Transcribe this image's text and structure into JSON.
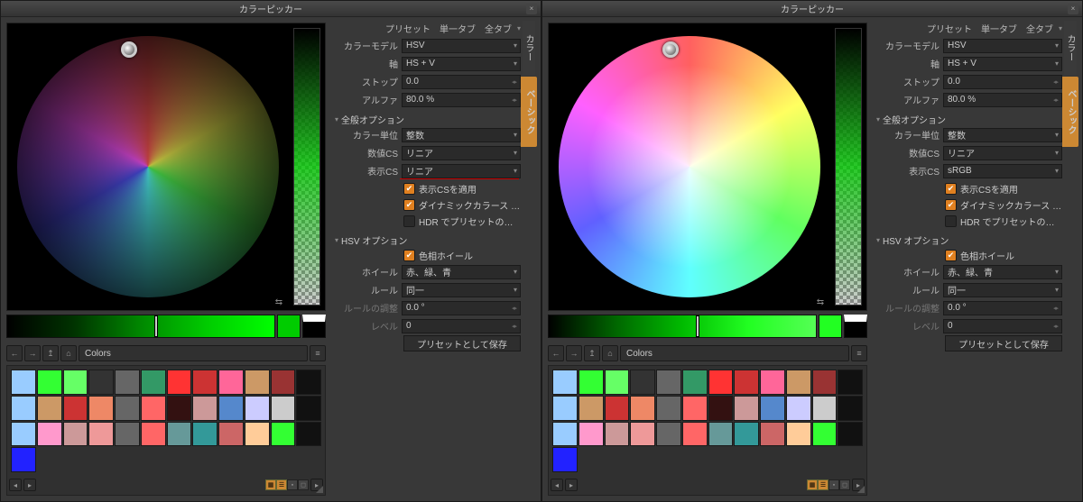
{
  "title": "カラーピッカー",
  "header": {
    "preset": "プリセット",
    "single": "単一タブ",
    "all": "全タブ"
  },
  "labels": {
    "color_model": "カラーモデル",
    "axis": "軸",
    "stop": "ストップ",
    "alpha": "アルファ",
    "general": "全般オプション",
    "color_unit": "カラー単位",
    "numeric_cs": "数値CS",
    "display_cs": "表示CS",
    "apply_display_cs": "表示CSを適用",
    "dynamic_color": "ダイナミックカラース …",
    "hdr_preset": "HDR でプリセットの…",
    "hsv_options": "HSV オプション",
    "hue_wheel": "色相ホイール",
    "wheel": "ホイール",
    "rule": "ルール",
    "rule_adjust": "ルールの調整",
    "level": "レベル",
    "save_preset": "プリセットとして保存",
    "vtab": "ベーシック",
    "vtab2": "カラー"
  },
  "left": {
    "color_model": "HSV",
    "axis": "HS + V",
    "stop": "0.0",
    "alpha": "80.0 %",
    "color_unit": "整数",
    "numeric_cs": "リニア",
    "display_cs": "リニア",
    "apply_display_cs": true,
    "dynamic_color": true,
    "hdr_preset": false,
    "hue_wheel": true,
    "wheel": "赤、緑、青",
    "rule": "同一",
    "rule_adjust": "0.0 °",
    "level": "0",
    "colors_label": "Colors"
  },
  "right": {
    "color_model": "HSV",
    "axis": "HS + V",
    "stop": "0.0",
    "alpha": "80.0 %",
    "color_unit": "整数",
    "numeric_cs": "リニア",
    "display_cs": "sRGB",
    "apply_display_cs": true,
    "dynamic_color": true,
    "hdr_preset": false,
    "hue_wheel": true,
    "wheel": "赤、緑、青",
    "rule": "同一",
    "rule_adjust": "0.0 °",
    "level": "0",
    "colors_label": "Colors"
  },
  "swatches": [
    "#99ccff",
    "#33ff33",
    "#66ff66",
    "#333333",
    "#666666",
    "#339966",
    "#ff3333",
    "#cc3333",
    "#ff6699",
    "#cc9966",
    "#993333",
    "#111111",
    "#99ccff",
    "#cc9966",
    "#cc3333",
    "#ee8866",
    "#666666",
    "#ff6666",
    "#331111",
    "#cc9999",
    "#5588cc",
    "#ccccff",
    "#cccccc",
    "#111111",
    "#99ccff",
    "#ff99cc",
    "#cc9999",
    "#ee9999",
    "#666666",
    "#ff6666",
    "#669999",
    "#339999",
    "#cc6666",
    "#ffcc99",
    "#33ff33",
    "#111111",
    "#2222ff"
  ]
}
